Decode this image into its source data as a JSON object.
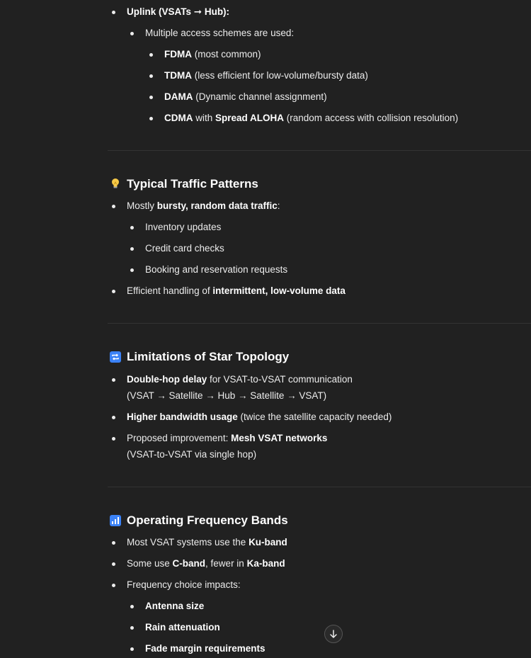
{
  "uplink": {
    "title": "Uplink (VSATs ➞ Hub):",
    "intro": "Multiple access schemes are used:",
    "schemes": [
      {
        "bold": "FDMA",
        "rest": " (most common)"
      },
      {
        "bold": "TDMA",
        "rest": " (less efficient for low-volume/bursty data)"
      },
      {
        "bold": "DAMA",
        "rest": " (Dynamic channel assignment)"
      }
    ],
    "cdma": {
      "b1": "CDMA",
      "t1": " with ",
      "b2": "Spread ALOHA",
      "t2": " (random access with collision resolution)"
    }
  },
  "traffic": {
    "icon": "lightbulb-icon",
    "heading": "Typical Traffic Patterns",
    "item1": {
      "pre": "Mostly ",
      "bold": "bursty, random data traffic",
      "post": ":"
    },
    "subitems": [
      "Inventory updates",
      "Credit card checks",
      "Booking and reservation requests"
    ],
    "item2": {
      "pre": "Efficient handling of ",
      "bold": "intermittent, low-volume data"
    }
  },
  "limitations": {
    "icon": "repeat-icon",
    "heading": "Limitations of Star Topology",
    "item1": {
      "bold": "Double-hop delay",
      "rest": " for VSAT-to-VSAT communication",
      "line2": "(VSAT → Satellite → Hub → Satellite → VSAT)"
    },
    "item2": {
      "bold": "Higher bandwidth usage",
      "rest": " (twice the satellite capacity needed)"
    },
    "item3": {
      "pre": "Proposed improvement: ",
      "bold": "Mesh VSAT networks",
      "line2": "(VSAT-to-VSAT via single hop)"
    }
  },
  "bands": {
    "icon": "bar-chart-icon",
    "heading": "Operating Frequency Bands",
    "item1": {
      "pre": "Most VSAT systems use the ",
      "bold": "Ku-band"
    },
    "item2": {
      "pre": "Some use ",
      "bold1": "C-band",
      "mid": ", fewer in ",
      "bold2": "Ka-band"
    },
    "item3": "Frequency choice impacts:",
    "subitems": [
      "Antenna size",
      "Rain attenuation",
      "Fade margin requirements"
    ]
  },
  "scroll_button": {
    "icon": "arrow-down-icon"
  }
}
